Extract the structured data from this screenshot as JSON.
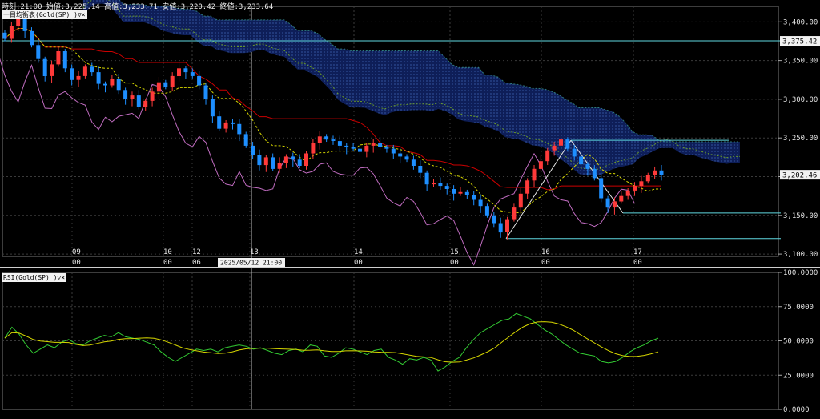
{
  "header": {
    "ohlc_text": "時刻:21:00 始値:3,225.14 高値:3,233.71 安値:3,220.42 終値:3,233.64"
  },
  "main_chart": {
    "indicator_tag": "一目均衡表(Gold(SP) )▽×",
    "y_axis_ticks": [
      "3,400.00",
      "3,350.00",
      "3,300.00",
      "3,250.00",
      "3,200.00",
      "3,150.00",
      "3,100.00"
    ],
    "y_axis_values": [
      3400,
      3350,
      3300,
      3250,
      3200,
      3150,
      3100
    ],
    "ylim": [
      3097,
      3420
    ],
    "price_label_top": "3,375.42",
    "price_label_top_value": 3375.42,
    "price_label_current": "3,202.46",
    "price_label_current_value": 3202.46,
    "date_labels": [
      {
        "day": "09",
        "hour": "00"
      },
      {
        "day": "10",
        "hour": "00"
      },
      {
        "day": "12",
        "hour": "06"
      },
      {
        "day": "13",
        "hour": ""
      },
      {
        "day": "14",
        "hour": "00"
      },
      {
        "day": "15",
        "hour": "00"
      },
      {
        "day": "16",
        "hour": "00"
      },
      {
        "day": "17",
        "hour": "00"
      }
    ],
    "crosshair_date_label": "2025/05/12 21:00",
    "colors": {
      "up_candle": "#ff3a3a",
      "down_candle": "#1e8fff",
      "kijun": "#cc0000",
      "tenkan": "#d6d600",
      "chikou": "#c06cc0",
      "span_a": "#6a9a2a",
      "cloud": "#0e1e58",
      "fib_lines": "#5fd8e0"
    }
  },
  "rsi_panel": {
    "indicator_tag": "RSI(Gold(SP) )▽×",
    "y_axis_ticks": [
      "100.0000",
      "75.0000",
      "50.0000",
      "25.0000",
      "0.0000"
    ],
    "y_axis_values": [
      100,
      75,
      50,
      25,
      0
    ],
    "ylim": [
      0,
      100
    ],
    "colors": {
      "rsi": "#33cc33",
      "signal": "#d6d600"
    }
  },
  "chart_data": {
    "type": "candlestick",
    "title": "",
    "xlabel": "",
    "ylabel": "",
    "grid": true,
    "closes": [
      3378,
      3395,
      3405,
      3388,
      3370,
      3352,
      3330,
      3345,
      3362,
      3340,
      3325,
      3330,
      3342,
      3335,
      3320,
      3318,
      3326,
      3312,
      3300,
      3305,
      3290,
      3298,
      3310,
      3322,
      3316,
      3330,
      3340,
      3335,
      3330,
      3318,
      3300,
      3278,
      3262,
      3270,
      3268,
      3255,
      3240,
      3228,
      3215,
      3225,
      3210,
      3218,
      3226,
      3222,
      3214,
      3230,
      3244,
      3252,
      3248,
      3246,
      3240,
      3238,
      3236,
      3232,
      3240,
      3244,
      3238,
      3236,
      3230,
      3226,
      3222,
      3214,
      3205,
      3190,
      3192,
      3188,
      3184,
      3178,
      3180,
      3176,
      3170,
      3162,
      3150,
      3140,
      3128,
      3145,
      3160,
      3178,
      3195,
      3210,
      3220,
      3234,
      3240,
      3248,
      3236,
      3226,
      3216,
      3210,
      3198,
      3172,
      3160,
      3168,
      3175,
      3182,
      3188,
      3194,
      3202,
      3208,
      3202
    ],
    "rsi": [
      52,
      60,
      55,
      47,
      41,
      44,
      47,
      45,
      49,
      51,
      48,
      47,
      50,
      52,
      54,
      53,
      56,
      53,
      52,
      51,
      49,
      47,
      42,
      38,
      35,
      38,
      41,
      44,
      43,
      44,
      42,
      45,
      46,
      47,
      46,
      44,
      45,
      43,
      41,
      40,
      43,
      44,
      42,
      47,
      46,
      39,
      38,
      41,
      45,
      44,
      42,
      40,
      43,
      44,
      38,
      36,
      33,
      37,
      36,
      38,
      36,
      28,
      31,
      35,
      38,
      45,
      51,
      56,
      59,
      62,
      65,
      66,
      70,
      68,
      66,
      62,
      58,
      55,
      51,
      47,
      44,
      41,
      40,
      39,
      35,
      34,
      35,
      38,
      42,
      45,
      47,
      50,
      52
    ]
  }
}
